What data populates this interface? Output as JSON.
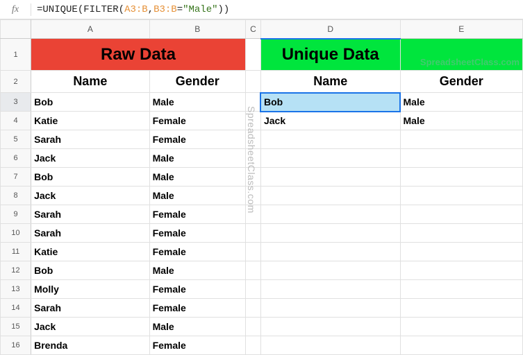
{
  "formula": {
    "eq": "=",
    "fn1": "UNIQUE",
    "fn2": "FILTER",
    "ref1": "A3:B",
    "comma": ",",
    "ref2": "B3:B",
    "eqop": "=",
    "str": "\"Male\"",
    "open": "(",
    "close": ")"
  },
  "columns": [
    "A",
    "B",
    "C",
    "D",
    "E"
  ],
  "rows": [
    "1",
    "2",
    "3",
    "4",
    "5",
    "6",
    "7",
    "8",
    "9",
    "10",
    "11",
    "12",
    "13",
    "14",
    "15",
    "16"
  ],
  "titles": {
    "raw": "Raw Data",
    "unique": "Unique Data"
  },
  "headers": {
    "name": "Name",
    "gender": "Gender"
  },
  "raw": [
    {
      "name": "Bob",
      "gender": "Male"
    },
    {
      "name": "Katie",
      "gender": "Female"
    },
    {
      "name": "Sarah",
      "gender": "Female"
    },
    {
      "name": "Jack",
      "gender": "Male"
    },
    {
      "name": "Bob",
      "gender": "Male"
    },
    {
      "name": "Jack",
      "gender": "Male"
    },
    {
      "name": "Sarah",
      "gender": "Female"
    },
    {
      "name": "Sarah",
      "gender": "Female"
    },
    {
      "name": "Katie",
      "gender": "Female"
    },
    {
      "name": "Bob",
      "gender": "Male"
    },
    {
      "name": "Molly",
      "gender": "Female"
    },
    {
      "name": "Sarah",
      "gender": "Female"
    },
    {
      "name": "Jack",
      "gender": "Male"
    },
    {
      "name": "Brenda",
      "gender": "Female"
    }
  ],
  "unique": [
    {
      "name": "Bob",
      "gender": "Male"
    },
    {
      "name": "Jack",
      "gender": "Male"
    }
  ],
  "watermark": "SpreadsheetClass.com"
}
